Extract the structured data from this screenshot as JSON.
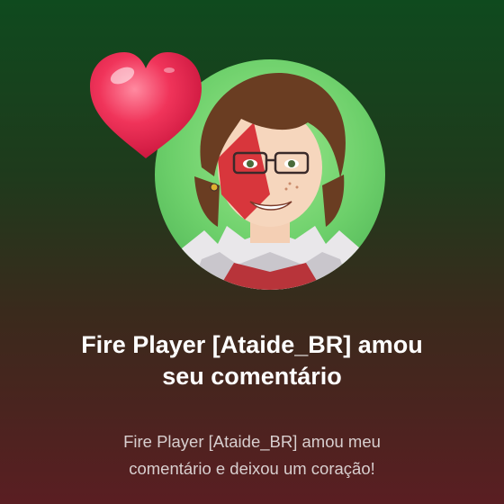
{
  "notification": {
    "title_line1": "Fire Player [Ataide_BR] amou",
    "title_line2": "seu comentário",
    "message_line1": "Fire Player [Ataide_BR] amou meu",
    "message_line2": "comentário e deixou um coração!"
  },
  "icons": {
    "avatar": "user-avatar",
    "badge": "heart-icon"
  },
  "colors": {
    "bg_top": "#0f4a1e",
    "bg_bottom": "#5a1e22",
    "heart": "#f0345a",
    "avatar_bg": "#6ccf6a"
  }
}
